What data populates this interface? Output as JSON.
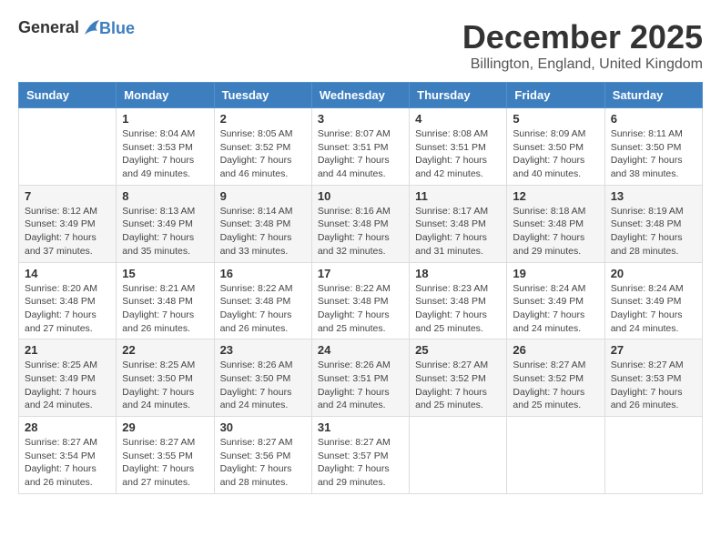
{
  "logo": {
    "line1": "General",
    "line2": "Blue"
  },
  "title": "December 2025",
  "location": "Billington, England, United Kingdom",
  "days_of_week": [
    "Sunday",
    "Monday",
    "Tuesday",
    "Wednesday",
    "Thursday",
    "Friday",
    "Saturday"
  ],
  "weeks": [
    [
      {
        "day": "",
        "info": ""
      },
      {
        "day": "1",
        "info": "Sunrise: 8:04 AM\nSunset: 3:53 PM\nDaylight: 7 hours\nand 49 minutes."
      },
      {
        "day": "2",
        "info": "Sunrise: 8:05 AM\nSunset: 3:52 PM\nDaylight: 7 hours\nand 46 minutes."
      },
      {
        "day": "3",
        "info": "Sunrise: 8:07 AM\nSunset: 3:51 PM\nDaylight: 7 hours\nand 44 minutes."
      },
      {
        "day": "4",
        "info": "Sunrise: 8:08 AM\nSunset: 3:51 PM\nDaylight: 7 hours\nand 42 minutes."
      },
      {
        "day": "5",
        "info": "Sunrise: 8:09 AM\nSunset: 3:50 PM\nDaylight: 7 hours\nand 40 minutes."
      },
      {
        "day": "6",
        "info": "Sunrise: 8:11 AM\nSunset: 3:50 PM\nDaylight: 7 hours\nand 38 minutes."
      }
    ],
    [
      {
        "day": "7",
        "info": "Sunrise: 8:12 AM\nSunset: 3:49 PM\nDaylight: 7 hours\nand 37 minutes."
      },
      {
        "day": "8",
        "info": "Sunrise: 8:13 AM\nSunset: 3:49 PM\nDaylight: 7 hours\nand 35 minutes."
      },
      {
        "day": "9",
        "info": "Sunrise: 8:14 AM\nSunset: 3:48 PM\nDaylight: 7 hours\nand 33 minutes."
      },
      {
        "day": "10",
        "info": "Sunrise: 8:16 AM\nSunset: 3:48 PM\nDaylight: 7 hours\nand 32 minutes."
      },
      {
        "day": "11",
        "info": "Sunrise: 8:17 AM\nSunset: 3:48 PM\nDaylight: 7 hours\nand 31 minutes."
      },
      {
        "day": "12",
        "info": "Sunrise: 8:18 AM\nSunset: 3:48 PM\nDaylight: 7 hours\nand 29 minutes."
      },
      {
        "day": "13",
        "info": "Sunrise: 8:19 AM\nSunset: 3:48 PM\nDaylight: 7 hours\nand 28 minutes."
      }
    ],
    [
      {
        "day": "14",
        "info": "Sunrise: 8:20 AM\nSunset: 3:48 PM\nDaylight: 7 hours\nand 27 minutes."
      },
      {
        "day": "15",
        "info": "Sunrise: 8:21 AM\nSunset: 3:48 PM\nDaylight: 7 hours\nand 26 minutes."
      },
      {
        "day": "16",
        "info": "Sunrise: 8:22 AM\nSunset: 3:48 PM\nDaylight: 7 hours\nand 26 minutes."
      },
      {
        "day": "17",
        "info": "Sunrise: 8:22 AM\nSunset: 3:48 PM\nDaylight: 7 hours\nand 25 minutes."
      },
      {
        "day": "18",
        "info": "Sunrise: 8:23 AM\nSunset: 3:48 PM\nDaylight: 7 hours\nand 25 minutes."
      },
      {
        "day": "19",
        "info": "Sunrise: 8:24 AM\nSunset: 3:49 PM\nDaylight: 7 hours\nand 24 minutes."
      },
      {
        "day": "20",
        "info": "Sunrise: 8:24 AM\nSunset: 3:49 PM\nDaylight: 7 hours\nand 24 minutes."
      }
    ],
    [
      {
        "day": "21",
        "info": "Sunrise: 8:25 AM\nSunset: 3:49 PM\nDaylight: 7 hours\nand 24 minutes."
      },
      {
        "day": "22",
        "info": "Sunrise: 8:25 AM\nSunset: 3:50 PM\nDaylight: 7 hours\nand 24 minutes."
      },
      {
        "day": "23",
        "info": "Sunrise: 8:26 AM\nSunset: 3:50 PM\nDaylight: 7 hours\nand 24 minutes."
      },
      {
        "day": "24",
        "info": "Sunrise: 8:26 AM\nSunset: 3:51 PM\nDaylight: 7 hours\nand 24 minutes."
      },
      {
        "day": "25",
        "info": "Sunrise: 8:27 AM\nSunset: 3:52 PM\nDaylight: 7 hours\nand 25 minutes."
      },
      {
        "day": "26",
        "info": "Sunrise: 8:27 AM\nSunset: 3:52 PM\nDaylight: 7 hours\nand 25 minutes."
      },
      {
        "day": "27",
        "info": "Sunrise: 8:27 AM\nSunset: 3:53 PM\nDaylight: 7 hours\nand 26 minutes."
      }
    ],
    [
      {
        "day": "28",
        "info": "Sunrise: 8:27 AM\nSunset: 3:54 PM\nDaylight: 7 hours\nand 26 minutes."
      },
      {
        "day": "29",
        "info": "Sunrise: 8:27 AM\nSunset: 3:55 PM\nDaylight: 7 hours\nand 27 minutes."
      },
      {
        "day": "30",
        "info": "Sunrise: 8:27 AM\nSunset: 3:56 PM\nDaylight: 7 hours\nand 28 minutes."
      },
      {
        "day": "31",
        "info": "Sunrise: 8:27 AM\nSunset: 3:57 PM\nDaylight: 7 hours\nand 29 minutes."
      },
      {
        "day": "",
        "info": ""
      },
      {
        "day": "",
        "info": ""
      },
      {
        "day": "",
        "info": ""
      }
    ]
  ]
}
